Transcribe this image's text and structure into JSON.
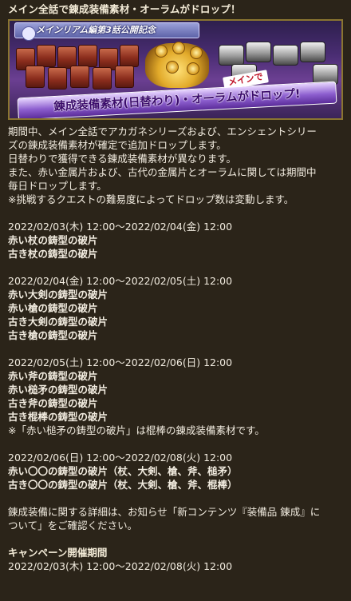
{
  "title": "メイン全話で錬成装備素材・オーラムがドロップ！",
  "banner": {
    "ribbon_text": "メインリアム編第3話公開記念",
    "sub_text": "メインで",
    "headline": "錬成装備素材(日替わり)・オーラムがドロップ!"
  },
  "intro": [
    "期間中、メイン全話でアカガネシリーズおよび、エンシェントシリー",
    "ズの錬成装備素材が確定で追加ドロップします。",
    "日替わりで獲得できる錬成装備素材が異なります。",
    "また、赤い金属片および、古代の金属片とオーラムに関しては期間中",
    "毎日ドロップします。",
    "※挑戦するクエストの難易度によってドロップ数は変動します。"
  ],
  "schedules": [
    {
      "period": "2022/02/03(木) 12:00～2022/02/04(金) 12:00",
      "items": [
        "赤い杖の鋳型の破片",
        "古き杖の鋳型の破片"
      ],
      "note": ""
    },
    {
      "period": "2022/02/04(金) 12:00～2022/02/05(土) 12:00",
      "items": [
        "赤い大剣の鋳型の破片",
        "赤い槍の鋳型の破片",
        "古き大剣の鋳型の破片",
        "古き槍の鋳型の破片"
      ],
      "note": ""
    },
    {
      "period": "2022/02/05(土) 12:00～2022/02/06(日) 12:00",
      "items": [
        "赤い斧の鋳型の破片",
        "赤い槌矛の鋳型の破片",
        "古き斧の鋳型の破片",
        "古き棍棒の鋳型の破片"
      ],
      "note": "※「赤い槌矛の鋳型の破片」は棍棒の錬成装備素材です。"
    },
    {
      "period": "2022/02/06(日) 12:00～2022/02/08(火) 12:00",
      "items": [
        "赤い〇〇の鋳型の破片（杖、大剣、槍、斧、槌矛）",
        "古き〇〇の鋳型の破片（杖、大剣、槍、斧、棍棒）"
      ],
      "note": ""
    }
  ],
  "details": [
    "錬成装備に関する詳細は、お知らせ「新コンテンツ『装備品 錬成』に",
    "ついて」をご確認ください。"
  ],
  "campaign": {
    "label": "キャンペーン開催期間",
    "period": "2022/02/03(木) 12:00～2022/02/08(火) 12:00"
  }
}
